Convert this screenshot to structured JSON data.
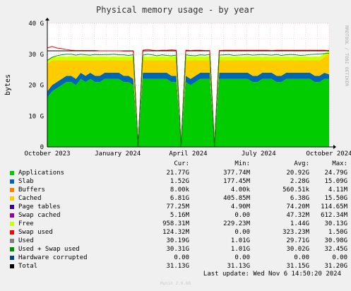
{
  "title": "Physical memory usage - by year",
  "side_text": "RRDTOOL / TOBI OETIKER",
  "footer": {
    "last_update": "Last update: Wed Nov  6 14:50:20 2024",
    "generator": "Munin 2.0.66"
  },
  "legend_headers": {
    "cur": "Cur:",
    "min": "Min:",
    "avg": "Avg:",
    "max": "Max:"
  },
  "legend": [
    {
      "name": "Applications",
      "color": "#00cc00",
      "cur": "21.77G",
      "min": "377.74M",
      "avg": "20.92G",
      "max": "24.79G"
    },
    {
      "name": "Slab",
      "color": "#0066b3",
      "cur": "1.52G",
      "min": "177.45M",
      "avg": "2.28G",
      "max": "15.09G"
    },
    {
      "name": "Buffers",
      "color": "#ff8000",
      "cur": "8.00k",
      "min": "4.00k",
      "avg": "560.51k",
      "max": "4.11M"
    },
    {
      "name": "Cached",
      "color": "#ffcc00",
      "cur": "6.81G",
      "min": "405.85M",
      "avg": "6.38G",
      "max": "15.50G"
    },
    {
      "name": "Page tables",
      "color": "#330099",
      "cur": "77.25M",
      "min": "4.90M",
      "avg": "74.20M",
      "max": "114.65M"
    },
    {
      "name": "Swap cached",
      "color": "#990099",
      "cur": "5.16M",
      "min": "0.00",
      "avg": "47.32M",
      "max": "612.34M"
    },
    {
      "name": "Free",
      "color": "#ccff00",
      "cur": "958.31M",
      "min": "229.23M",
      "avg": "1.44G",
      "max": "30.13G"
    },
    {
      "name": "Swap used",
      "color": "#ff0000",
      "cur": "124.32M",
      "min": "0.00",
      "avg": "323.23M",
      "max": "1.50G"
    },
    {
      "name": "Used",
      "color": "#808080",
      "cur": "30.19G",
      "min": "1.01G",
      "avg": "29.71G",
      "max": "30.98G"
    },
    {
      "name": "Used + Swap used",
      "color": "#008f00",
      "cur": "30.31G",
      "min": "1.01G",
      "avg": "30.02G",
      "max": "32.45G"
    },
    {
      "name": "Hardware corrupted",
      "color": "#00487d",
      "cur": "0.00",
      "min": "0.00",
      "avg": "0.00",
      "max": "0.00"
    },
    {
      "name": "Total",
      "color": "#000000",
      "cur": "31.13G",
      "min": "31.13G",
      "avg": "31.15G",
      "max": "31.20G"
    }
  ],
  "chart_data": {
    "type": "area",
    "title": "Physical memory usage - by year",
    "ylabel": "bytes",
    "ylim": [
      0,
      40
    ],
    "y_unit": "G",
    "y_ticks": [
      {
        "value": 0,
        "label": "0"
      },
      {
        "value": 10,
        "label": "10 G"
      },
      {
        "value": 20,
        "label": "20 G"
      },
      {
        "value": 30,
        "label": "30 G"
      },
      {
        "value": 40,
        "label": "40 G"
      }
    ],
    "x_ticks": [
      {
        "pos": 0.0,
        "label": "October 2023"
      },
      {
        "pos": 0.25,
        "label": "January 2024"
      },
      {
        "pos": 0.5,
        "label": "April 2024"
      },
      {
        "pos": 0.75,
        "label": "July 2024"
      },
      {
        "pos": 1.0,
        "label": "October 2024"
      }
    ],
    "grid": true,
    "stacked_series": [
      {
        "name": "Applications",
        "color": "#00cc00",
        "values": [
          16,
          18,
          19,
          20,
          21,
          21,
          20,
          22,
          21,
          22,
          21,
          21,
          22,
          22,
          22,
          22,
          21,
          21,
          20,
          0,
          22,
          22,
          22,
          22,
          22,
          22,
          21,
          21,
          0,
          21,
          20,
          21,
          22,
          22,
          22,
          0,
          22,
          22,
          22,
          22,
          22,
          22,
          22,
          21,
          21,
          22,
          22,
          22,
          21,
          21,
          22,
          22,
          22,
          22,
          22,
          22,
          21,
          21,
          22,
          22
        ]
      },
      {
        "name": "Slab",
        "color": "#0066b3",
        "values": [
          2,
          2,
          2,
          2,
          2,
          2,
          2,
          2,
          2,
          2,
          2,
          2,
          2,
          2,
          2,
          2,
          2,
          2,
          2,
          0,
          2,
          2,
          2,
          2,
          2,
          2,
          2,
          2,
          0,
          2,
          2,
          2,
          2,
          2,
          2,
          0,
          2,
          2,
          2,
          2,
          2,
          2,
          2,
          2,
          2,
          2,
          2,
          2,
          2,
          2,
          2,
          2,
          2,
          2,
          2,
          2,
          2,
          2,
          2,
          1.5
        ]
      },
      {
        "name": "Cached",
        "color": "#ffcc00",
        "values": [
          9,
          8,
          7,
          6,
          5,
          5,
          6,
          4,
          5,
          4,
          5,
          5,
          4,
          4,
          4,
          4,
          5,
          5,
          6,
          0,
          4,
          4,
          4,
          4,
          4,
          4,
          5,
          5,
          0,
          5,
          6,
          5,
          4,
          4,
          4,
          0,
          4,
          4,
          4,
          4,
          4,
          4,
          4,
          5,
          5,
          4,
          4,
          4,
          5,
          5,
          4,
          4,
          4,
          4,
          4,
          4,
          5,
          5,
          5,
          6.8
        ]
      },
      {
        "name": "Free",
        "color": "#ccff00",
        "values": [
          1,
          1,
          1.2,
          1.3,
          1.2,
          1.4,
          1.3,
          1.3,
          1.4,
          1.3,
          1.2,
          1.3,
          1.3,
          1.2,
          1.3,
          1.2,
          1.3,
          1.2,
          1.3,
          0,
          1.3,
          1.2,
          1.3,
          1.2,
          1.3,
          1.2,
          1.3,
          1.2,
          0,
          1.2,
          1.3,
          1.2,
          1.3,
          1.2,
          1.3,
          0,
          1.3,
          1.2,
          1.3,
          1.2,
          1.3,
          1.2,
          1.3,
          1.2,
          1.3,
          1.2,
          1.3,
          1.2,
          1.3,
          1.2,
          1.3,
          1.2,
          1.3,
          1.2,
          1.3,
          1.2,
          1.3,
          1.2,
          1.2,
          1
        ]
      }
    ],
    "line_series": [
      {
        "name": "Total",
        "color": "#000000",
        "values": [
          31.1,
          31.1,
          31.1,
          31.1,
          31.1,
          31.1,
          31.1,
          31.1,
          31.1,
          31.1,
          31.1,
          31.1,
          31.1,
          31.1,
          31.1,
          31.1,
          31.1,
          31.1,
          31.1,
          0,
          31.1,
          31.1,
          31.1,
          31.1,
          31.1,
          31.1,
          31.1,
          31.1,
          0,
          31.1,
          31.1,
          31.1,
          31.1,
          31.1,
          31.1,
          0,
          31.1,
          31.1,
          31.1,
          31.1,
          31.1,
          31.1,
          31.1,
          31.1,
          31.1,
          31.1,
          31.1,
          31.1,
          31.1,
          31.1,
          31.1,
          31.1,
          31.1,
          31.1,
          31.1,
          31.1,
          31.1,
          31.1,
          31.1,
          31.1
        ]
      },
      {
        "name": "Swap used",
        "color": "#ff0000",
        "values": [
          32,
          32.5,
          32,
          31.8,
          31.5,
          31.3,
          31.2,
          31.2,
          31.2,
          31.2,
          31.2,
          31.1,
          31.1,
          31.1,
          31.1,
          31.1,
          31,
          31,
          31,
          0,
          31.3,
          31.5,
          31.3,
          31.2,
          31.3,
          31.3,
          31.4,
          31.3,
          0,
          31.3,
          31.2,
          31.3,
          31.3,
          31.2,
          31.2,
          0,
          31.2,
          31.3,
          31.3,
          31.3,
          31.3,
          31.3,
          31.3,
          31.3,
          31.3,
          31.3,
          31.3,
          31.2,
          31.3,
          31.3,
          31.3,
          31.3,
          31.3,
          31.3,
          31.3,
          31.3,
          31.3,
          31.3,
          31.3,
          31.2
        ]
      },
      {
        "name": "Used + Swap used",
        "color": "#008f00",
        "values": [
          28,
          29,
          29.5,
          29.8,
          30,
          30,
          29.7,
          30,
          29.8,
          29.7,
          29.9,
          29.8,
          29.9,
          29.9,
          30,
          29.8,
          29.8,
          29.6,
          29.8,
          0,
          29.7,
          30,
          29.8,
          29.5,
          29.8,
          29.6,
          29.5,
          29.7,
          0,
          29.8,
          29.6,
          29.5,
          29.8,
          29.7,
          29.9,
          0,
          29.7,
          29.8,
          29.9,
          29.6,
          29.7,
          29.8,
          29.9,
          29.7,
          29.8,
          29.9,
          29.8,
          29.7,
          29.9,
          29.6,
          29.8,
          29.9,
          29.8,
          29.6,
          29.7,
          29.9,
          30,
          30.1,
          30.2,
          30.3
        ]
      }
    ]
  }
}
